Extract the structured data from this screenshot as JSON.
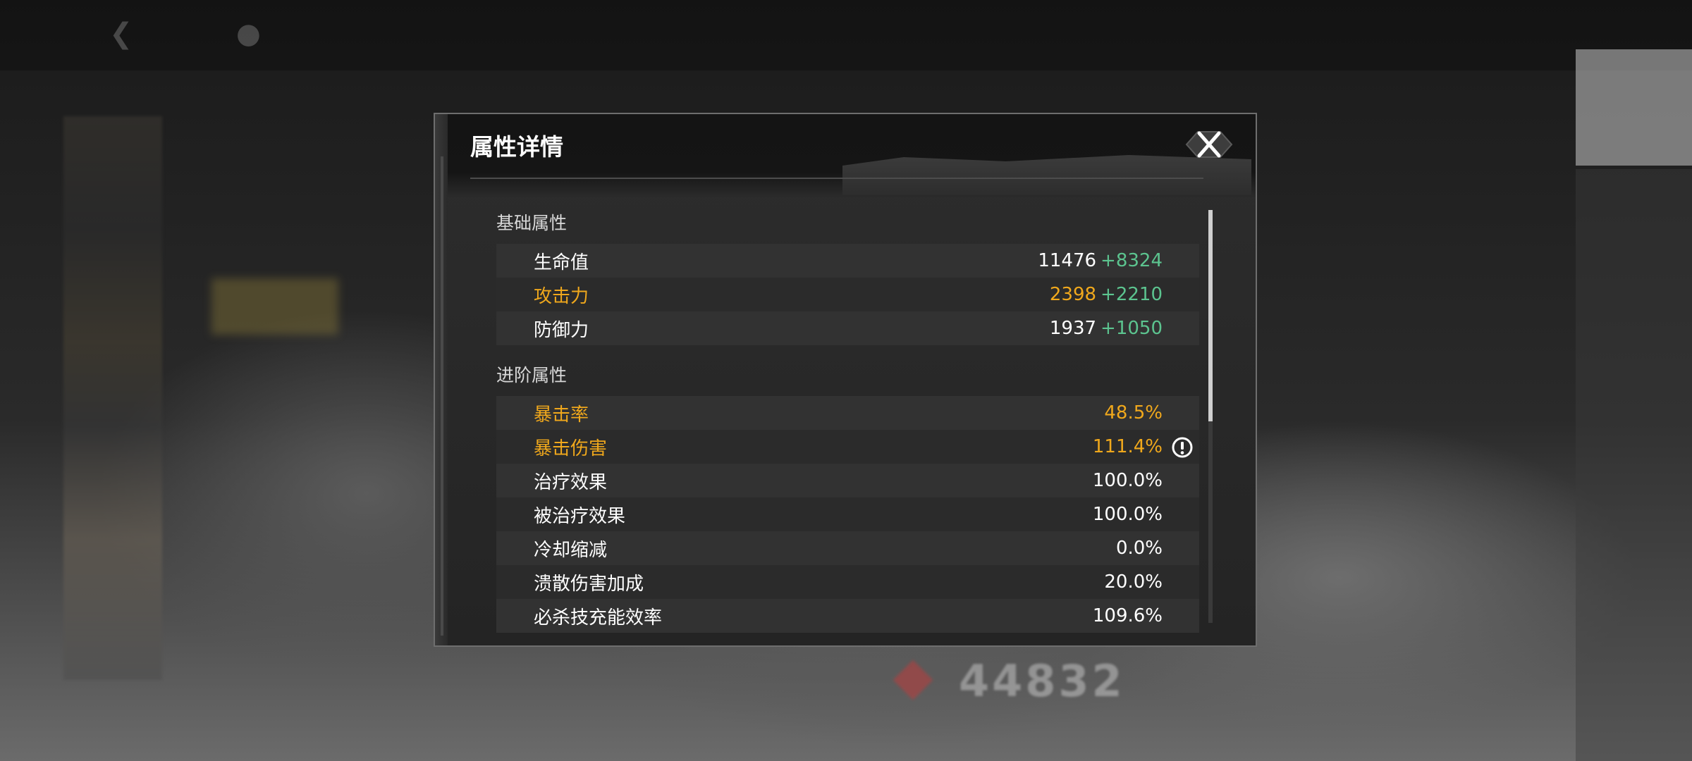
{
  "dialog": {
    "title": "属性详情"
  },
  "sections": [
    {
      "title": "基础属性",
      "rows": [
        {
          "name": "生命值",
          "value": "11476",
          "bonus": "+8324",
          "highlighted": false
        },
        {
          "name": "攻击力",
          "value": "2398",
          "bonus": "+2210",
          "highlighted": true
        },
        {
          "name": "防御力",
          "value": "1937",
          "bonus": "+1050",
          "highlighted": false
        }
      ]
    },
    {
      "title": "进阶属性",
      "rows": [
        {
          "name": "暴击率",
          "value": "48.5%",
          "highlighted": true
        },
        {
          "name": "暴击伤害",
          "value": "111.4%",
          "highlighted": true,
          "info_icon": "exclamation-circle-icon"
        },
        {
          "name": "治疗效果",
          "value": "100.0%",
          "highlighted": false
        },
        {
          "name": "被治疗效果",
          "value": "100.0%",
          "highlighted": false
        },
        {
          "name": "冷却缩减",
          "value": "0.0%",
          "highlighted": false
        },
        {
          "name": "溃散伤害加成",
          "value": "20.0%",
          "highlighted": false
        },
        {
          "name": "必杀技充能效率",
          "value": "109.6%",
          "highlighted": false
        }
      ]
    }
  ],
  "background": {
    "power_number": "44832"
  },
  "colors": {
    "highlight": "#f0a81c",
    "bonus": "#5cc48f",
    "text": "#ffffff",
    "panel": "#262626"
  }
}
